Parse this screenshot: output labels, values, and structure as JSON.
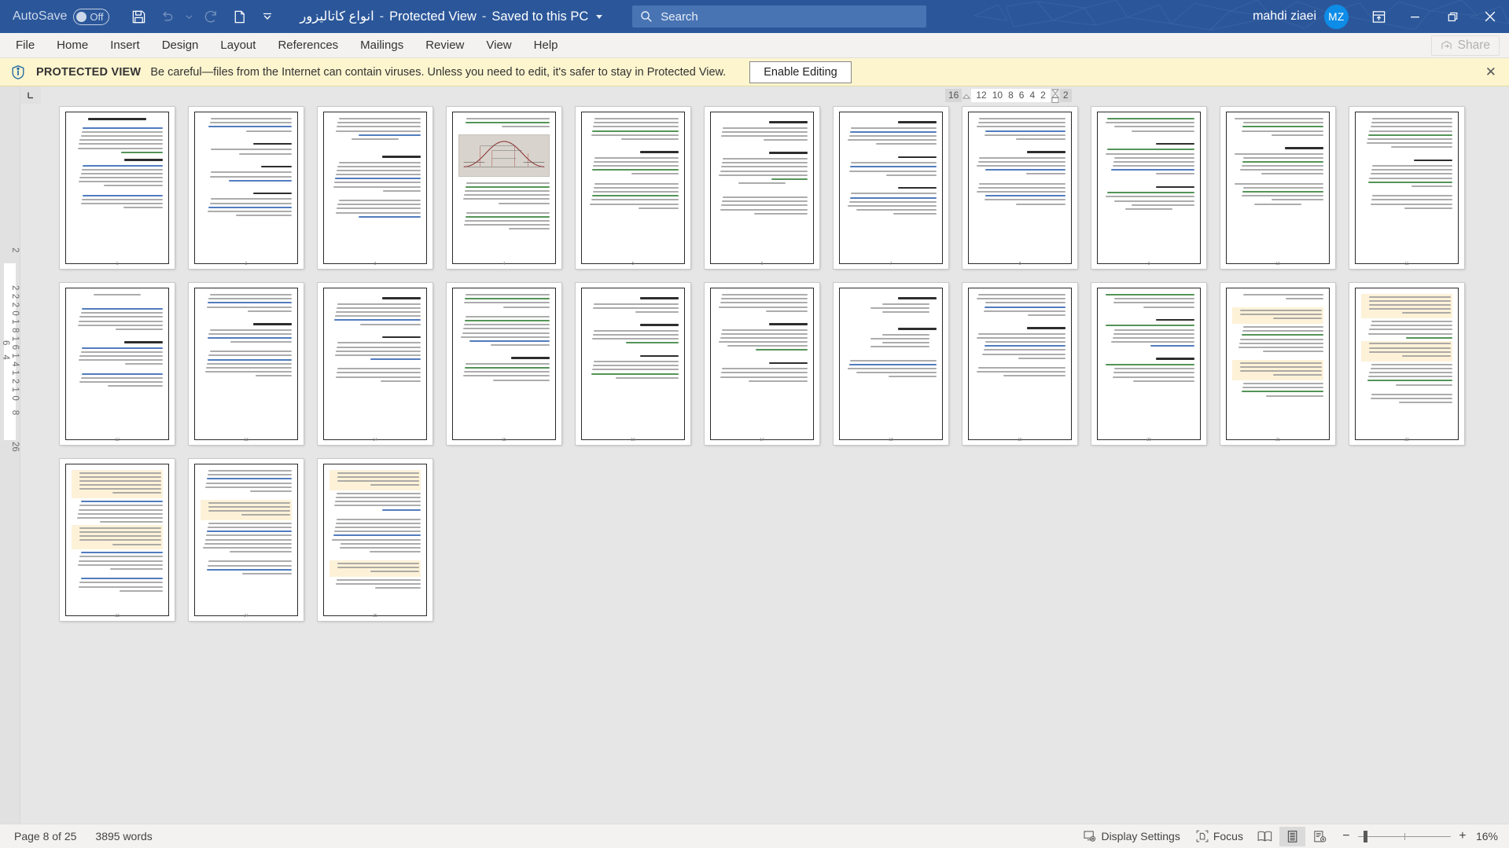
{
  "titlebar": {
    "autosave_label": "AutoSave",
    "autosave_state": "Off",
    "doc_title": "انواع کاتالیزور",
    "sep1": "-",
    "protected_view": "Protected View",
    "sep2": "-",
    "saved_state": "Saved to this PC",
    "search_placeholder": "Search",
    "user_name": "mahdi ziaei",
    "user_initials": "MZ",
    "qat": {
      "save": "save-icon",
      "undo": "undo-icon",
      "undo_more": "undo-dropdown",
      "redo": "redo-icon",
      "new": "new-document-icon",
      "customize": "customize-qat-icon"
    },
    "window": {
      "minimize": "minimize",
      "restore": "restore",
      "close": "close"
    },
    "ribbon_display": "ribbon-display-options",
    "accent_color": "#2b579a"
  },
  "ribbon": {
    "tabs": [
      {
        "label": "File",
        "active": false
      },
      {
        "label": "Home",
        "active": false
      },
      {
        "label": "Insert",
        "active": false
      },
      {
        "label": "Design",
        "active": false
      },
      {
        "label": "Layout",
        "active": false
      },
      {
        "label": "References",
        "active": false
      },
      {
        "label": "Mailings",
        "active": false
      },
      {
        "label": "Review",
        "active": false
      },
      {
        "label": "View",
        "active": false
      },
      {
        "label": "Help",
        "active": false
      }
    ],
    "share_label": "Share",
    "share_disabled": true
  },
  "protected_view": {
    "title": "PROTECTED VIEW",
    "message": "Be careful—files from the Internet can contain viruses. Unless you need to edit, it's safer to stay in Protected View.",
    "enable_label": "Enable Editing",
    "close_label": "✕",
    "bg_color": "#fdf5ce"
  },
  "rulers": {
    "corner_label": "L",
    "horizontal_left_number": "16",
    "horizontal_numbers": [
      "12",
      "10",
      "8",
      "6",
      "4",
      "2"
    ],
    "horizontal_right_number": "2",
    "vertical_top_number": "2",
    "vertical_numbers": "22201816141210 8 6 4",
    "vertical_bottom_number": "26"
  },
  "document": {
    "title_text": "انواع کاتالیزور و نقش آنها در صنعت",
    "total_pages": 25,
    "visible_pages": 25,
    "page_labels": [
      "1",
      "2",
      "3",
      "4",
      "5",
      "6",
      "7",
      "8",
      "9",
      "10",
      "11",
      "12",
      "13",
      "14",
      "15",
      "16",
      "17",
      "18",
      "19",
      "20",
      "21",
      "22",
      "23",
      "24",
      "25"
    ],
    "highlight_color": "#fdf2d8",
    "link_color": "#2b5fb0",
    "accent_text_color": "#2e7d32"
  },
  "statusbar": {
    "page_info": "Page 8 of 25",
    "word_count": "3895 words",
    "display_settings": "Display Settings",
    "focus": "Focus",
    "view_read_mode": "read-mode",
    "view_print_layout": "print-layout",
    "view_web_layout": "web-layout",
    "zoom_out": "−",
    "zoom_in": "+",
    "zoom_level": "16%"
  }
}
